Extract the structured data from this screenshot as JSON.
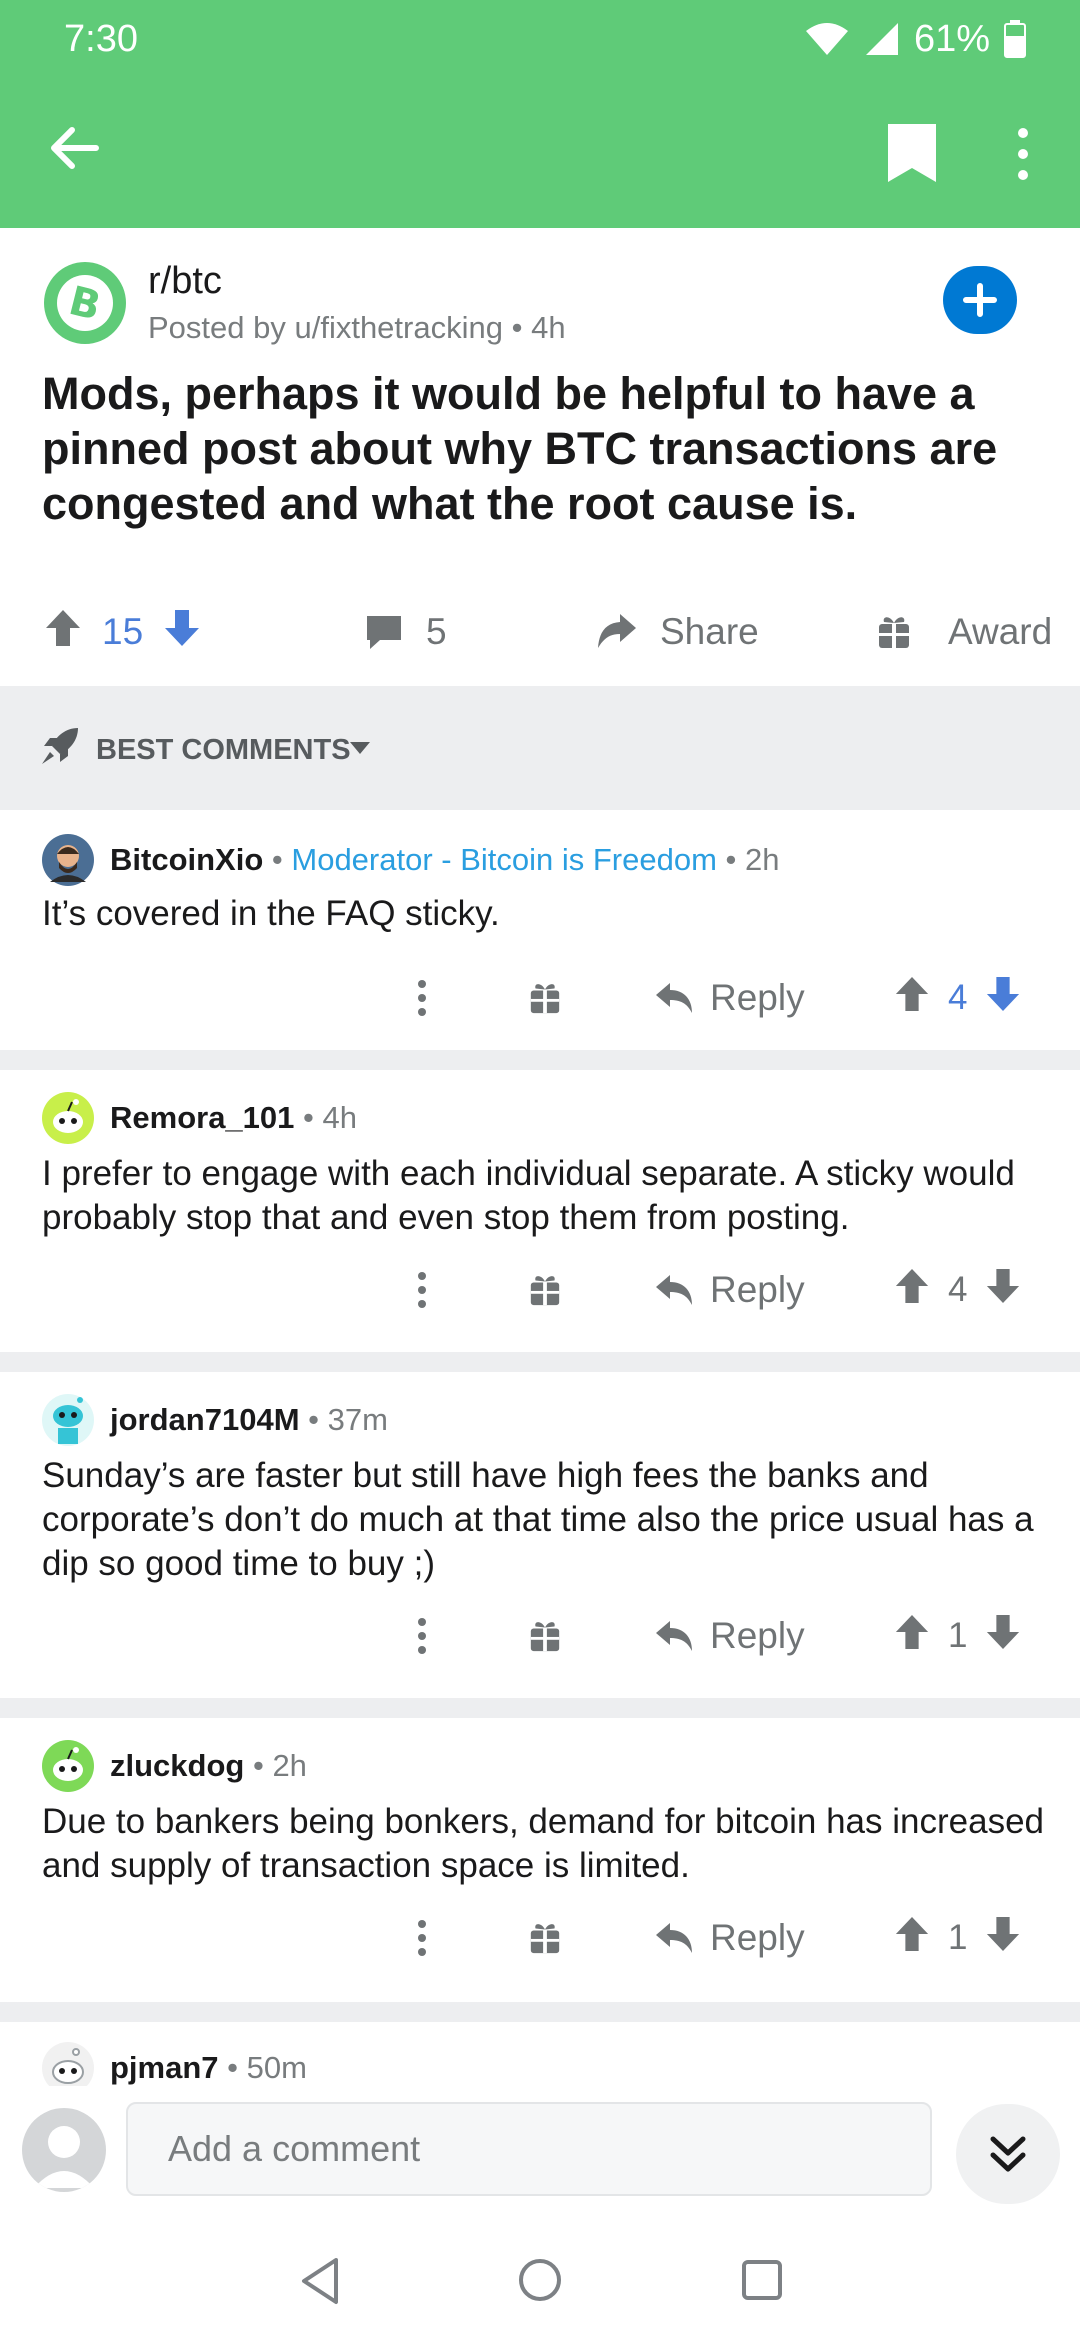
{
  "status": {
    "time": "7:30",
    "battery": "61%"
  },
  "post": {
    "subreddit": "r/btc",
    "posted_by": "Posted by u/fixthetracking",
    "age": "4h",
    "title": "Mods, perhaps it would be helpful to have a pinned post about why BTC transactions are congested and what the root cause is.",
    "votes": "15",
    "comments": "5",
    "share_label": "Share",
    "award_label": "Award"
  },
  "sort": {
    "label": "BEST COMMENTS"
  },
  "comments": [
    {
      "author": "BitcoinXio",
      "flair": "Moderator - Bitcoin is Freedom",
      "age": "2h",
      "body": "It’s covered in the FAQ sticky.",
      "votes": "4",
      "reply_label": "Reply"
    },
    {
      "author": "Remora_101",
      "age": "4h",
      "body": "I prefer to engage with each individual separate. A sticky would probably stop that and even stop them from posting.",
      "votes": "4",
      "reply_label": "Reply"
    },
    {
      "author": "jordan7104M",
      "age": "37m",
      "body": "Sunday’s are faster but still have high fees the banks and corporate’s don’t do much at that time also the price usual has a dip so good time to buy ;)",
      "votes": "1",
      "reply_label": "Reply"
    },
    {
      "author": "zluckdog",
      "age": "2h",
      "body": "Due to bankers being bonkers, demand for bitcoin has increased and supply of transaction space is limited.",
      "votes": "1",
      "reply_label": "Reply"
    },
    {
      "author": "pjman7",
      "age": "50m"
    }
  ],
  "composer": {
    "placeholder": "Add a comment"
  },
  "colors": {
    "app_bar": "#5fcb78",
    "upvote_active": "#4a7dd8",
    "join_button": "#0079d3",
    "flair": "#2a9ee0"
  }
}
